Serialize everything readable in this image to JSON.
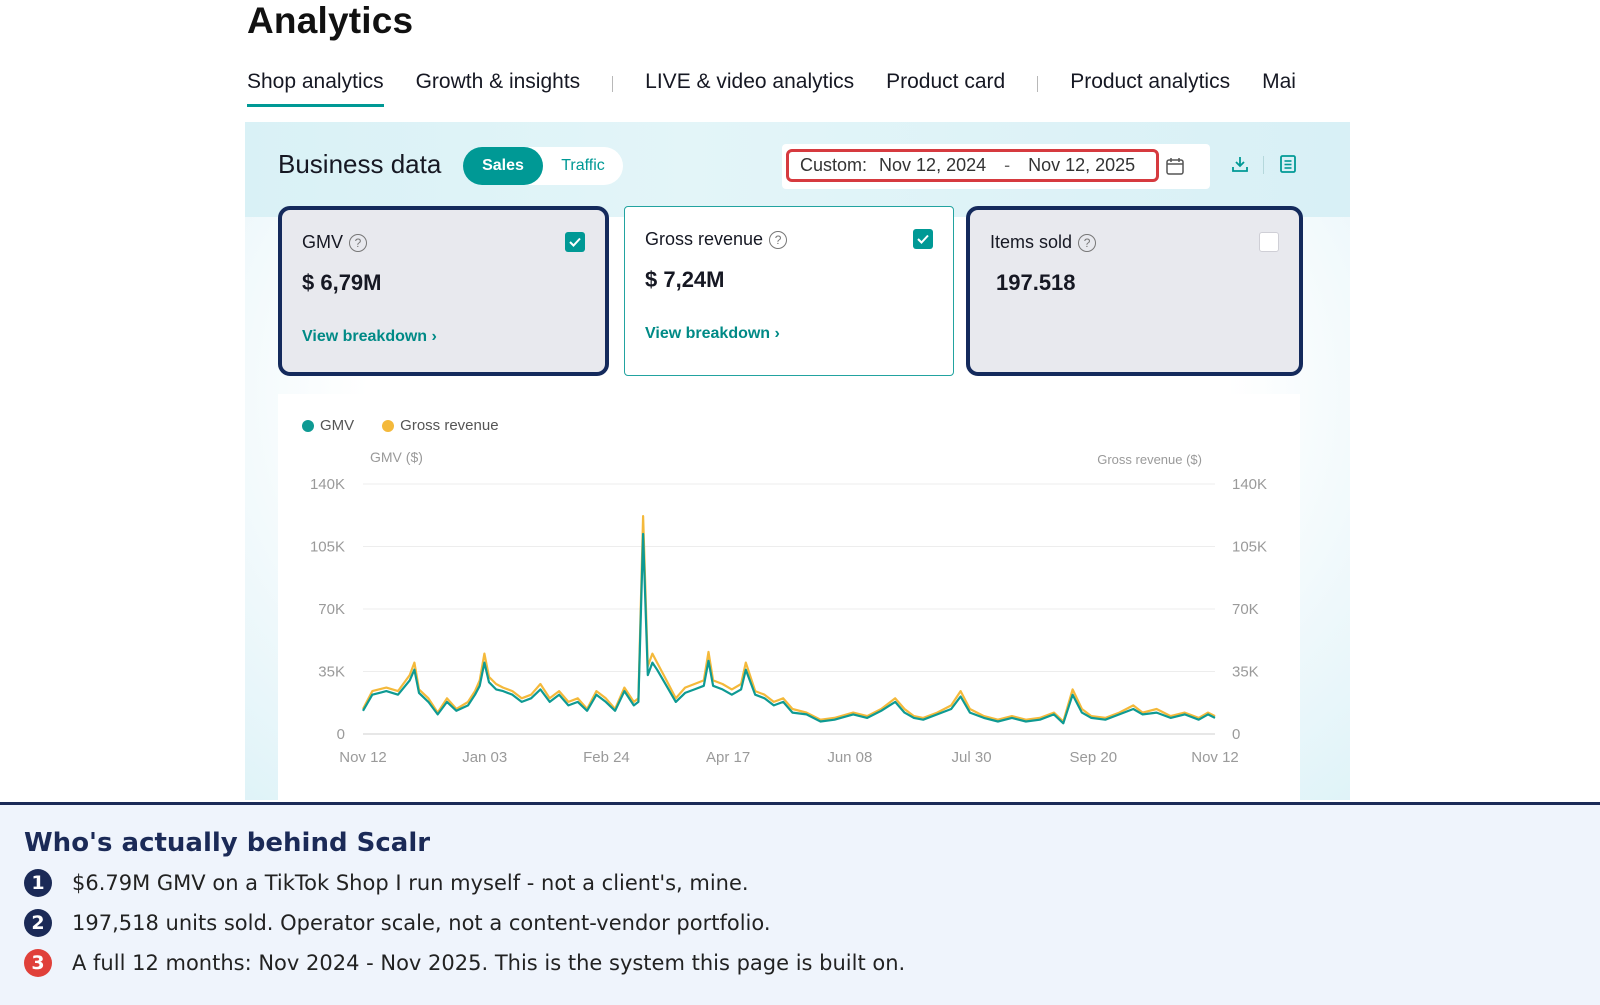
{
  "page": {
    "title": "Analytics"
  },
  "tabs": [
    {
      "label": "Shop analytics",
      "active": true
    },
    {
      "label": "Growth & insights"
    },
    {
      "label": "LIVE & video analytics"
    },
    {
      "label": "Product card"
    },
    {
      "label": "Product analytics"
    },
    {
      "label": "Mai"
    }
  ],
  "business_data": {
    "title": "Business data",
    "toggle": {
      "on": "Sales",
      "off": "Traffic"
    },
    "date": {
      "label": "Custom:",
      "start": "Nov 12, 2024",
      "separator": "-",
      "end": "Nov 12, 2025"
    }
  },
  "metrics": [
    {
      "name": "GMV",
      "value": "$ 6,79M",
      "link": "View breakdown ›",
      "checked": true
    },
    {
      "name": "Gross revenue",
      "value": "$ 7,24M",
      "link": "View breakdown ›",
      "checked": true
    },
    {
      "name": "Items sold",
      "value": "197.518",
      "checked": false
    }
  ],
  "colors": {
    "gmv": "#0e9a93",
    "gross_revenue": "#f4b93b",
    "accent": "#009995",
    "highlight_border": "#142a5c",
    "date_border": "#d63a3f"
  },
  "chart_data": {
    "type": "line",
    "legend": [
      "GMV",
      "Gross revenue"
    ],
    "ylabel_left": "GMV ($)",
    "ylabel_right": "Gross revenue ($)",
    "y_ticks": [
      "0",
      "35K",
      "70K",
      "105K",
      "140K"
    ],
    "ylim": [
      0,
      140000
    ],
    "x_ticks": [
      "Nov 12",
      "Jan 03",
      "Feb 24",
      "Apr 17",
      "Jun 08",
      "Jul 30",
      "Sep 20",
      "Nov 12"
    ],
    "x_range_days": [
      0,
      365
    ],
    "grid": true,
    "legend_position": "top-left",
    "series": [
      {
        "name": "Gross revenue",
        "color": "#f4b93b",
        "points": [
          [
            0,
            14000
          ],
          [
            4,
            24000
          ],
          [
            10,
            26000
          ],
          [
            15,
            24000
          ],
          [
            20,
            33000
          ],
          [
            22,
            40000
          ],
          [
            24,
            25000
          ],
          [
            28,
            20000
          ],
          [
            32,
            12000
          ],
          [
            36,
            20000
          ],
          [
            40,
            14000
          ],
          [
            45,
            18000
          ],
          [
            48,
            24000
          ],
          [
            50,
            30000
          ],
          [
            52,
            45000
          ],
          [
            54,
            32000
          ],
          [
            57,
            28000
          ],
          [
            60,
            26000
          ],
          [
            64,
            24000
          ],
          [
            68,
            20000
          ],
          [
            72,
            22000
          ],
          [
            76,
            28000
          ],
          [
            80,
            20000
          ],
          [
            84,
            24000
          ],
          [
            88,
            18000
          ],
          [
            92,
            20000
          ],
          [
            96,
            14000
          ],
          [
            100,
            24000
          ],
          [
            104,
            20000
          ],
          [
            108,
            14000
          ],
          [
            112,
            26000
          ],
          [
            116,
            18000
          ],
          [
            118,
            20000
          ],
          [
            120,
            122000
          ],
          [
            122,
            38000
          ],
          [
            124,
            45000
          ],
          [
            126,
            40000
          ],
          [
            130,
            30000
          ],
          [
            134,
            20000
          ],
          [
            138,
            26000
          ],
          [
            142,
            28000
          ],
          [
            146,
            30000
          ],
          [
            148,
            46000
          ],
          [
            150,
            30000
          ],
          [
            154,
            28000
          ],
          [
            158,
            25000
          ],
          [
            162,
            28000
          ],
          [
            164,
            40000
          ],
          [
            168,
            24000
          ],
          [
            172,
            22000
          ],
          [
            176,
            18000
          ],
          [
            180,
            20000
          ],
          [
            184,
            14000
          ],
          [
            190,
            12000
          ],
          [
            196,
            8000
          ],
          [
            202,
            9000
          ],
          [
            210,
            12000
          ],
          [
            216,
            10000
          ],
          [
            222,
            14000
          ],
          [
            228,
            20000
          ],
          [
            232,
            14000
          ],
          [
            236,
            10000
          ],
          [
            240,
            9000
          ],
          [
            246,
            12000
          ],
          [
            252,
            16000
          ],
          [
            256,
            24000
          ],
          [
            260,
            14000
          ],
          [
            266,
            10000
          ],
          [
            272,
            8000
          ],
          [
            278,
            10000
          ],
          [
            284,
            8000
          ],
          [
            290,
            9000
          ],
          [
            296,
            12000
          ],
          [
            300,
            7000
          ],
          [
            304,
            25000
          ],
          [
            308,
            14000
          ],
          [
            312,
            10000
          ],
          [
            318,
            9000
          ],
          [
            324,
            12000
          ],
          [
            330,
            16000
          ],
          [
            334,
            12000
          ],
          [
            340,
            14000
          ],
          [
            346,
            10000
          ],
          [
            352,
            12000
          ],
          [
            358,
            9000
          ],
          [
            362,
            12000
          ],
          [
            365,
            10000
          ]
        ]
      },
      {
        "name": "GMV",
        "color": "#0e9a93",
        "points": [
          [
            0,
            13000
          ],
          [
            4,
            22000
          ],
          [
            10,
            24000
          ],
          [
            15,
            22000
          ],
          [
            20,
            30000
          ],
          [
            22,
            36000
          ],
          [
            24,
            23000
          ],
          [
            28,
            18000
          ],
          [
            32,
            11000
          ],
          [
            36,
            18000
          ],
          [
            40,
            13000
          ],
          [
            45,
            16000
          ],
          [
            48,
            22000
          ],
          [
            50,
            27000
          ],
          [
            52,
            40000
          ],
          [
            54,
            29000
          ],
          [
            57,
            25000
          ],
          [
            60,
            24000
          ],
          [
            64,
            22000
          ],
          [
            68,
            18000
          ],
          [
            72,
            20000
          ],
          [
            76,
            25000
          ],
          [
            80,
            18000
          ],
          [
            84,
            22000
          ],
          [
            88,
            16000
          ],
          [
            92,
            18000
          ],
          [
            96,
            13000
          ],
          [
            100,
            22000
          ],
          [
            104,
            18000
          ],
          [
            108,
            13000
          ],
          [
            112,
            24000
          ],
          [
            116,
            16000
          ],
          [
            118,
            18000
          ],
          [
            120,
            112000
          ],
          [
            122,
            33000
          ],
          [
            124,
            40000
          ],
          [
            126,
            36000
          ],
          [
            130,
            27000
          ],
          [
            134,
            18000
          ],
          [
            138,
            23000
          ],
          [
            142,
            25000
          ],
          [
            146,
            27000
          ],
          [
            148,
            41000
          ],
          [
            150,
            27000
          ],
          [
            154,
            25000
          ],
          [
            158,
            22000
          ],
          [
            162,
            25000
          ],
          [
            164,
            36000
          ],
          [
            168,
            22000
          ],
          [
            172,
            20000
          ],
          [
            176,
            16000
          ],
          [
            180,
            18000
          ],
          [
            184,
            12000
          ],
          [
            190,
            11000
          ],
          [
            196,
            7000
          ],
          [
            202,
            8000
          ],
          [
            210,
            11000
          ],
          [
            216,
            9000
          ],
          [
            222,
            13000
          ],
          [
            228,
            18000
          ],
          [
            232,
            12000
          ],
          [
            236,
            9000
          ],
          [
            240,
            8000
          ],
          [
            246,
            11000
          ],
          [
            252,
            14000
          ],
          [
            256,
            21000
          ],
          [
            260,
            12000
          ],
          [
            266,
            9000
          ],
          [
            272,
            7000
          ],
          [
            278,
            9000
          ],
          [
            284,
            7000
          ],
          [
            290,
            8000
          ],
          [
            296,
            11000
          ],
          [
            300,
            6000
          ],
          [
            304,
            22000
          ],
          [
            308,
            12000
          ],
          [
            312,
            9000
          ],
          [
            318,
            8000
          ],
          [
            324,
            11000
          ],
          [
            330,
            14000
          ],
          [
            334,
            11000
          ],
          [
            340,
            12000
          ],
          [
            346,
            9000
          ],
          [
            352,
            11000
          ],
          [
            358,
            8000
          ],
          [
            362,
            11000
          ],
          [
            365,
            9000
          ]
        ]
      }
    ]
  },
  "notes": {
    "title": "Who's actually behind Scalr",
    "items": [
      {
        "num": "1",
        "text": "$6.79M GMV on a TikTok Shop I run myself - not a client's, mine.",
        "color": "#1b2a57"
      },
      {
        "num": "2",
        "text": "197,518 units sold. Operator scale, not a content-vendor portfolio.",
        "color": "#1b2a57"
      },
      {
        "num": "3",
        "text": "A full 12 months: Nov 2024 - Nov 2025. This is the system this page is built on.",
        "color": "#e0403a"
      }
    ]
  }
}
